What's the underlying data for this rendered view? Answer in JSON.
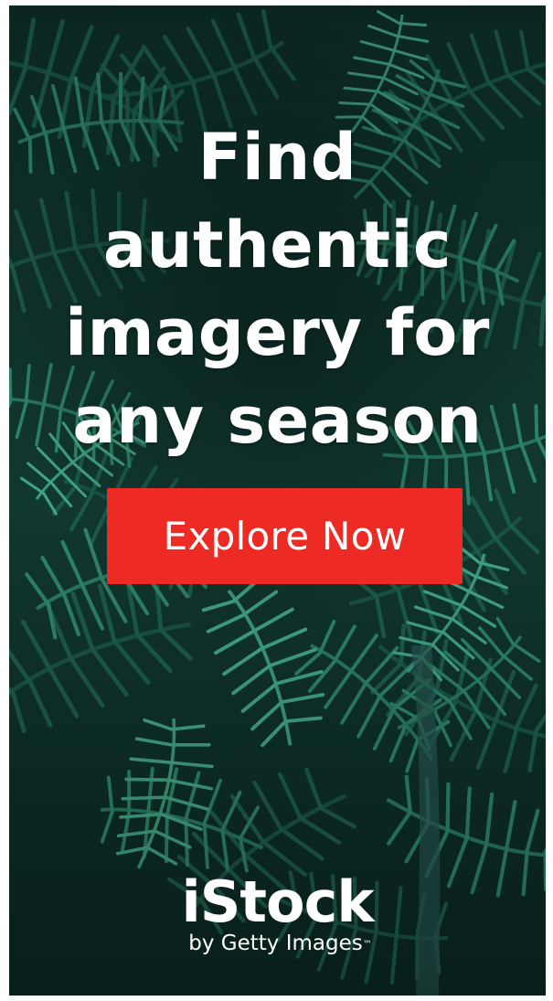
{
  "ad": {
    "headline_lines": [
      "Find",
      "authentic",
      "imagery for",
      "any season"
    ],
    "cta_label": "Explore Now",
    "brand": {
      "logo_word": "iStock",
      "logo_sub": "by Getty Images",
      "trademark": "™"
    },
    "background": "tropical-palm-foliage-image",
    "colors": {
      "cta": "#ee2a24",
      "text": "#ffffff",
      "foliage_dark": "#0c2a24",
      "foliage_mid": "#1f6b56",
      "foliage_light": "#3fa085"
    }
  }
}
